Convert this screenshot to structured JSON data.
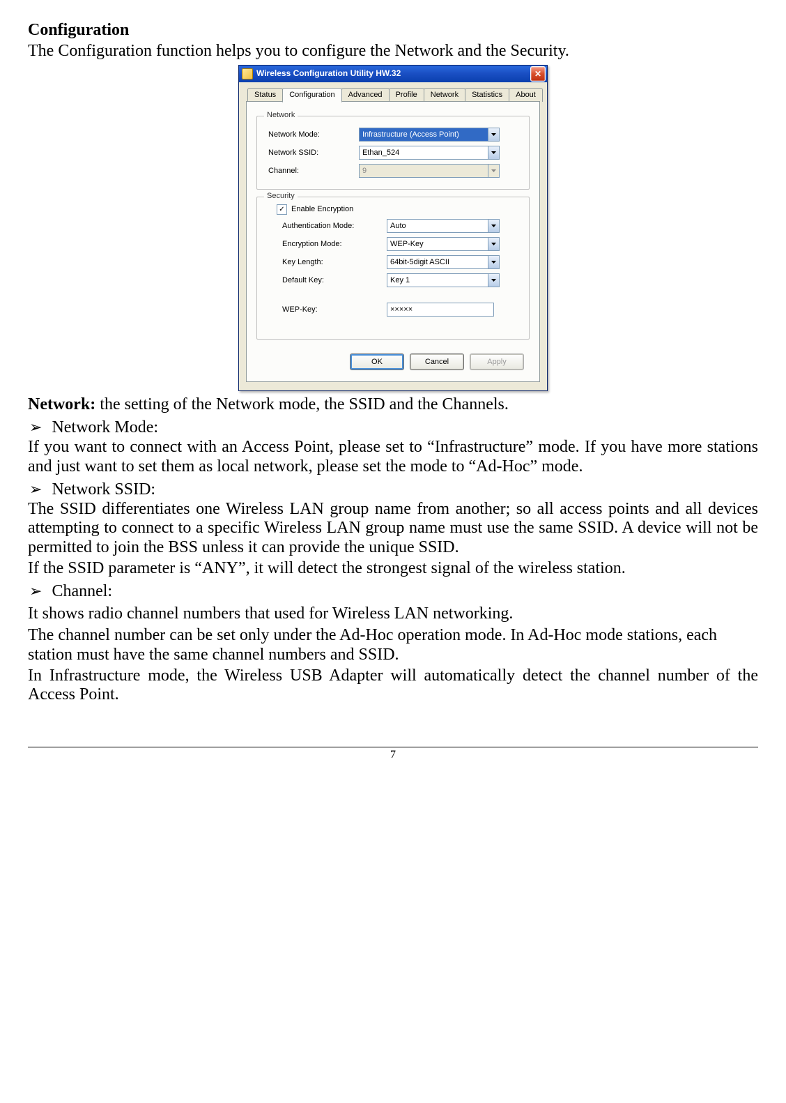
{
  "doc": {
    "heading": "Configuration",
    "intro": "The Configuration function helps you to configure the Network and the Security.",
    "network_label": "Network:",
    "network_desc": " the setting of the Network mode, the SSID and the Channels.",
    "bullet_symbol": "➢",
    "bullet1": "Network Mode:",
    "para1": "If you want to connect with an Access Point, please set to “Infrastructure” mode. If you have more stations and just want to set them as local network, please set the mode to “Ad-Hoc” mode.",
    "bullet2": "Network SSID:",
    "para2a": "The SSID differentiates one Wireless LAN group name from another; so all access points and all devices attempting to connect to a specific Wireless LAN group name must use the same SSID. A device will not be permitted to join the BSS unless it can provide the unique SSID.",
    "para2b": "If the SSID parameter is “ANY”, it will detect the strongest signal of the wireless station.",
    "bullet3": "Channel:",
    "para3a": "It shows radio channel numbers that used for Wireless LAN networking.",
    "para3b": "The channel number can be set only under the Ad-Hoc operation mode. In Ad-Hoc mode stations, each station must have the same channel numbers and SSID.",
    "para3c": "In Infrastructure mode, the Wireless USB Adapter will automatically detect the channel number of the Access Point.",
    "page_number": "7"
  },
  "dialog": {
    "title": "Wireless Configuration Utility HW.32",
    "tabs": [
      "Status",
      "Configuration",
      "Advanced",
      "Profile",
      "Network",
      "Statistics",
      "About"
    ],
    "active_tab_index": 1,
    "network_group": "Network",
    "security_group": "Security",
    "labels": {
      "network_mode": "Network Mode:",
      "network_ssid": "Network SSID:",
      "channel": "Channel:",
      "enable_enc": "Enable Encryption",
      "auth_mode": "Authentication Mode:",
      "enc_mode": "Encryption Mode:",
      "key_len": "Key Length:",
      "def_key": "Default Key:",
      "wep_key": "WEP-Key:"
    },
    "values": {
      "network_mode": "Infrastructure (Access Point)",
      "network_ssid": "Ethan_524",
      "channel": "9",
      "enable_enc_checked": true,
      "auth_mode": "Auto",
      "enc_mode": "WEP-Key",
      "key_len": "64bit-5digit ASCII",
      "def_key": "Key 1",
      "wep_key": "×××××"
    },
    "buttons": {
      "ok": "OK",
      "cancel": "Cancel",
      "apply": "Apply"
    }
  }
}
